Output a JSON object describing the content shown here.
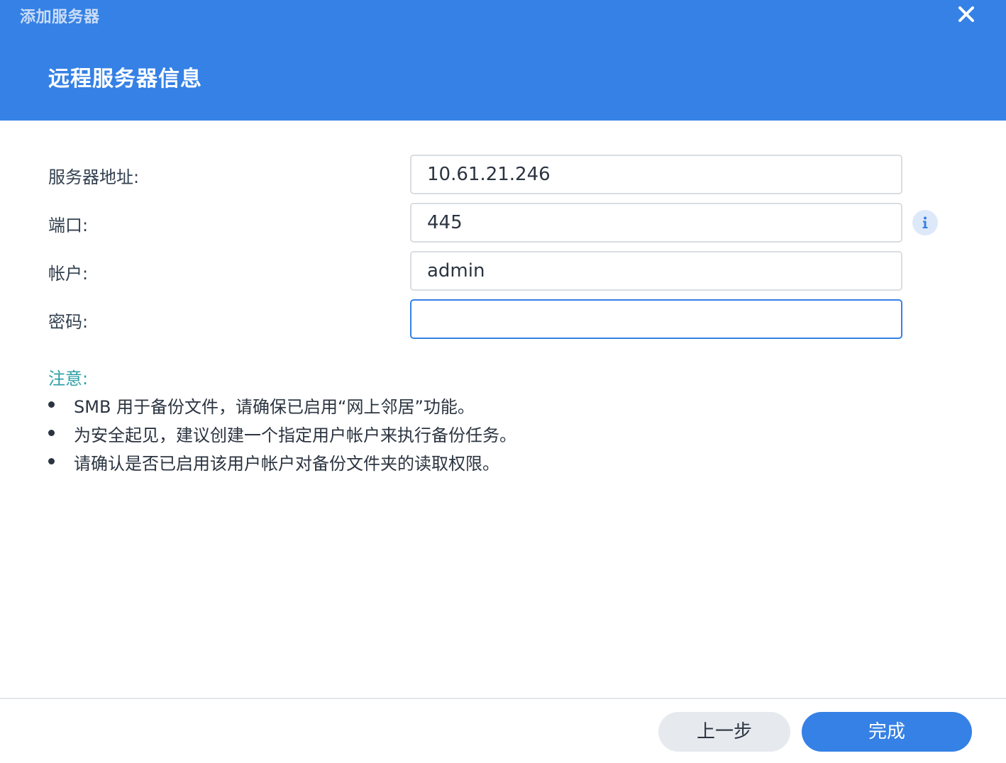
{
  "header": {
    "window_title": "添加服务器",
    "step_title": "远程服务器信息",
    "close_icon": "close-icon",
    "background_color": "#3581e5"
  },
  "form": {
    "server_address": {
      "label": "服务器地址:",
      "value": "10.61.21.246"
    },
    "port": {
      "label": "端口:",
      "value": "445",
      "help_icon": "info-icon"
    },
    "account": {
      "label": "帐户:",
      "value": "admin"
    },
    "password": {
      "label": "密码:",
      "value": ""
    }
  },
  "notes": {
    "title": "注意:",
    "items": [
      "SMB 用于备份文件，请确保已启用“网上邻居”功能。",
      "为安全起见，建议创建一个指定用户帐户来执行备份任务。",
      "请确认是否已启用该用户帐户对备份文件夹的读取权限。"
    ],
    "title_color": "#2fa0a5"
  },
  "footer": {
    "back_label": "上一步",
    "finish_label": "完成",
    "accent_color": "#3581e5"
  }
}
